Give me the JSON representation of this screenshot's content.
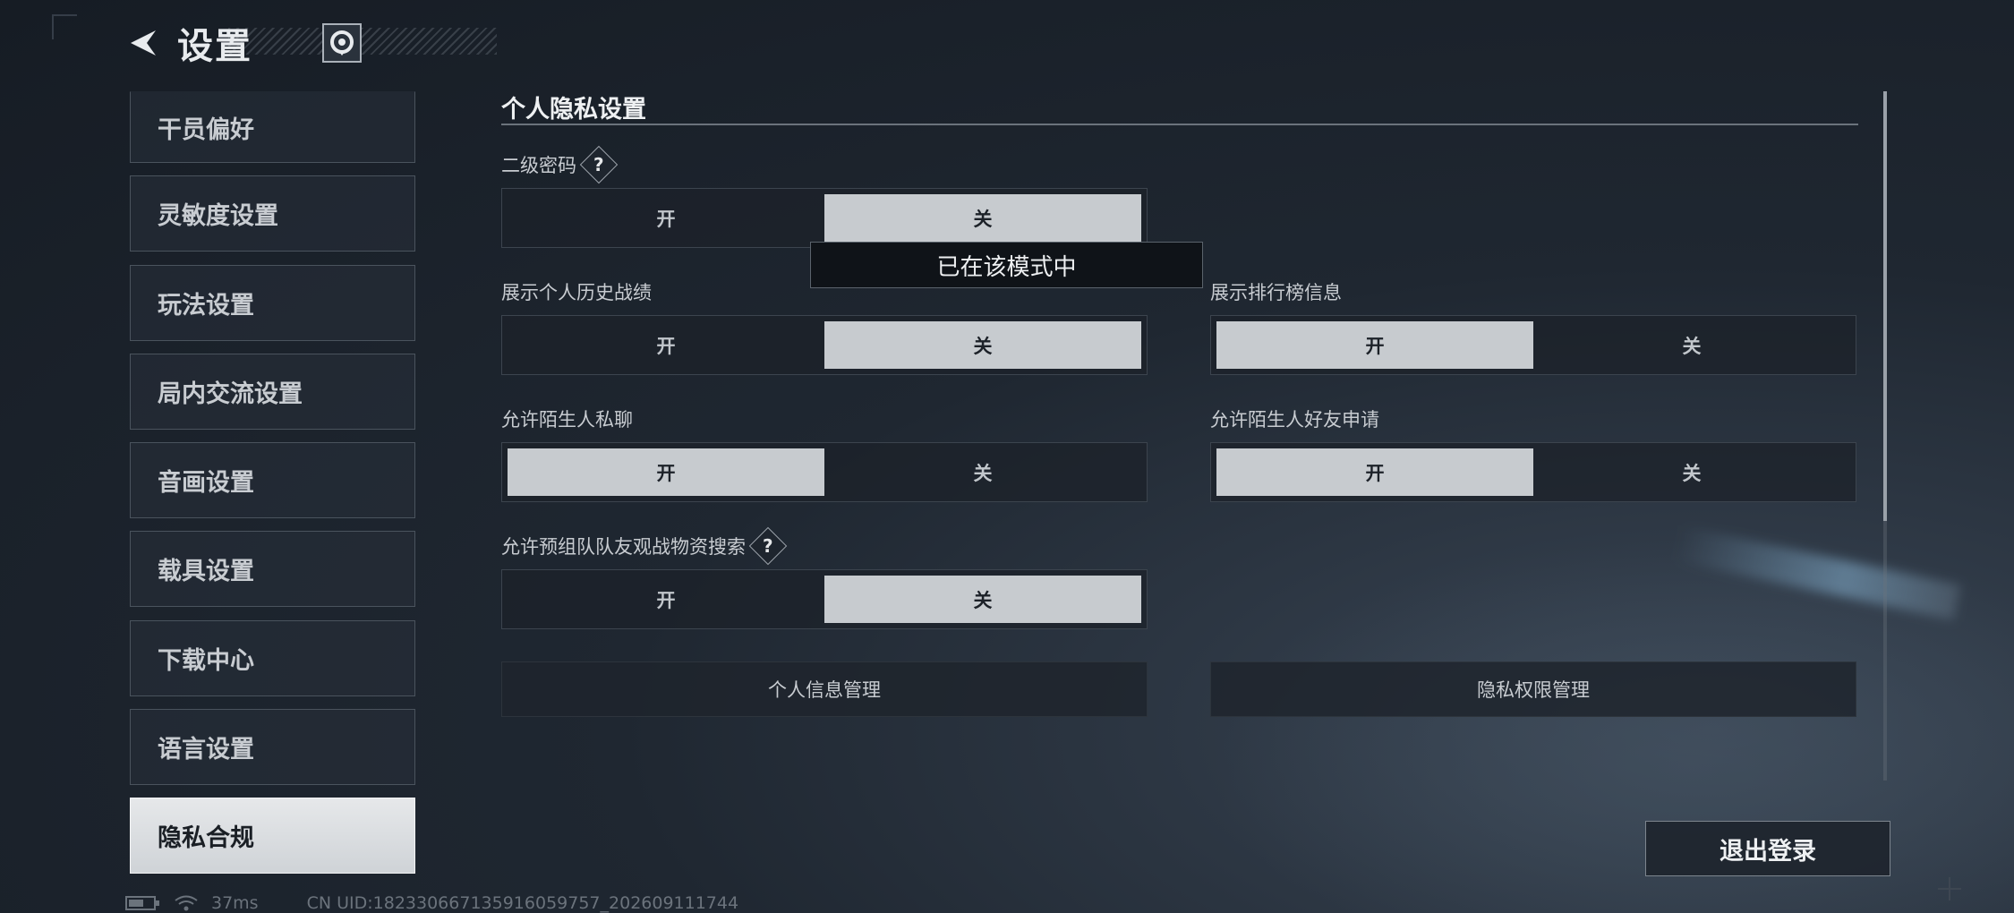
{
  "header": {
    "title": "设置"
  },
  "sidebar": {
    "items": [
      {
        "label": "干员偏好"
      },
      {
        "label": "灵敏度设置"
      },
      {
        "label": "玩法设置"
      },
      {
        "label": "局内交流设置"
      },
      {
        "label": "音画设置"
      },
      {
        "label": "载具设置"
      },
      {
        "label": "下载中心"
      },
      {
        "label": "语言设置"
      },
      {
        "label": "隐私合规"
      }
    ],
    "active": "隐私合规"
  },
  "privacy": {
    "section_title": "个人隐私设置",
    "tooltip": "已在该模式中",
    "settings": [
      {
        "label": "二级密码",
        "on": "开",
        "off": "关",
        "selected": "关",
        "help": true
      },
      {
        "label": "展示个人历史战绩",
        "on": "开",
        "off": "关",
        "selected": "关"
      },
      {
        "label": "展示排行榜信息",
        "on": "开",
        "off": "关",
        "selected": "开"
      },
      {
        "label": "允许陌生人私聊",
        "on": "开",
        "off": "关",
        "selected": "开"
      },
      {
        "label": "允许陌生人好友申请",
        "on": "开",
        "off": "关",
        "selected": "开"
      },
      {
        "label": "允许预组队队友观战物资搜索",
        "on": "开",
        "off": "关",
        "selected": "关",
        "help": true
      }
    ],
    "help_glyph": "?",
    "buttons": {
      "personal_info": "个人信息管理",
      "privacy_permissions": "隐私权限管理"
    }
  },
  "logout": {
    "label": "退出登录"
  },
  "status": {
    "ping": "37ms",
    "uid": "CN UID:1823306671359160597​57_202609111744"
  },
  "colors": {
    "selected_bg": "#c7cbcf",
    "active_sidebar_bg": "#e6e8ea"
  }
}
